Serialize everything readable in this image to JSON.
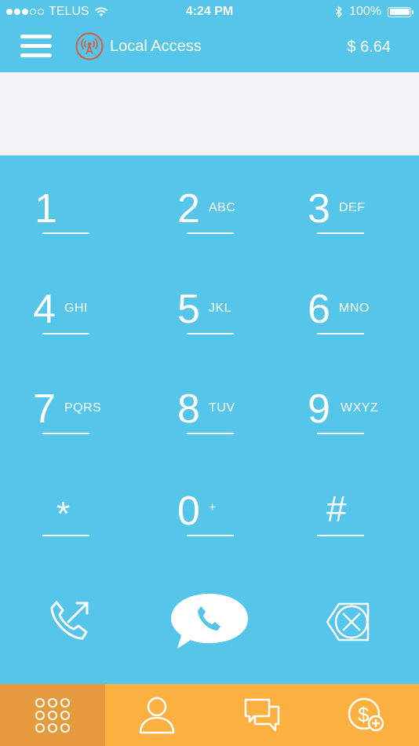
{
  "status_bar": {
    "carrier": "TELUS",
    "time": "4:24 PM",
    "battery": "100%",
    "signal_bars_filled": 3,
    "signal_bars_total": 5
  },
  "header": {
    "access_label": "Local Access",
    "balance": "$ 6.64"
  },
  "display": {
    "number": ""
  },
  "keypad": {
    "keys": [
      {
        "digit": "1",
        "letters": ""
      },
      {
        "digit": "2",
        "letters": "ABC"
      },
      {
        "digit": "3",
        "letters": "DEF"
      },
      {
        "digit": "4",
        "letters": "GHI"
      },
      {
        "digit": "5",
        "letters": "JKL"
      },
      {
        "digit": "6",
        "letters": "MNO"
      },
      {
        "digit": "7",
        "letters": "PQRS"
      },
      {
        "digit": "8",
        "letters": "TUV"
      },
      {
        "digit": "9",
        "letters": "WXYZ"
      },
      {
        "digit": "*",
        "letters": ""
      },
      {
        "digit": "0",
        "letters": "+"
      },
      {
        "digit": "#",
        "letters": ""
      }
    ]
  },
  "actions": {
    "left_icon": "outgoing-call-icon",
    "center_icon": "chat-call-icon",
    "right_icon": "backspace-icon"
  },
  "tabs": [
    {
      "icon": "keypad-icon",
      "active": true
    },
    {
      "icon": "contacts-icon",
      "active": false
    },
    {
      "icon": "messages-icon",
      "active": false
    },
    {
      "icon": "add-credit-icon",
      "active": false
    }
  ],
  "colors": {
    "primary": "#55c5e9",
    "display_bg": "#f2f2f7",
    "tab_bar": "#fbb040",
    "tab_active": "#e69b3f",
    "access_icon": "#e0593a"
  }
}
